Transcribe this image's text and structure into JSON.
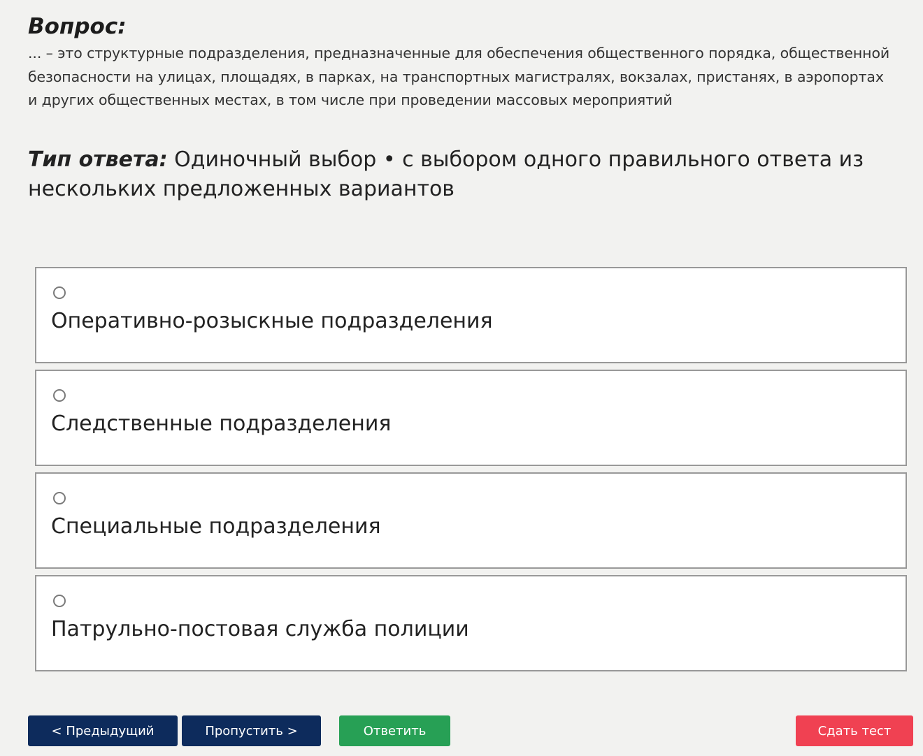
{
  "question": {
    "heading": "Вопрос:",
    "text": "... – это структурные подразделения, предназначенные для обеспечения общественного порядка, общественной безопасности на улицах, площадях, в парках, на транспортных магистралях, вокзалах, пристанях, в аэропортах и других общественных местах, в том числе при проведении массовых мероприятий"
  },
  "answer_type": {
    "label": "Тип ответа:",
    "value": " Одиночный выбор • с выбором одного правильного ответа из нескольких предложенных вариантов"
  },
  "options": [
    {
      "label": "Оперативно-розыскные подразделения",
      "selected": false
    },
    {
      "label": "Следственные подразделения",
      "selected": false
    },
    {
      "label": "Специальные подразделения",
      "selected": false
    },
    {
      "label": "Патрульно-постовая служба полиции",
      "selected": false
    }
  ],
  "buttons": {
    "prev": "< Предыдущий",
    "skip": "Пропустить >",
    "answer": "Ответить",
    "finish": "Сдать тест"
  },
  "colors": {
    "background": "#f2f2f0",
    "nav_button": "#0d2b5c",
    "answer_button": "#27a055",
    "finish_button": "#f04152"
  }
}
